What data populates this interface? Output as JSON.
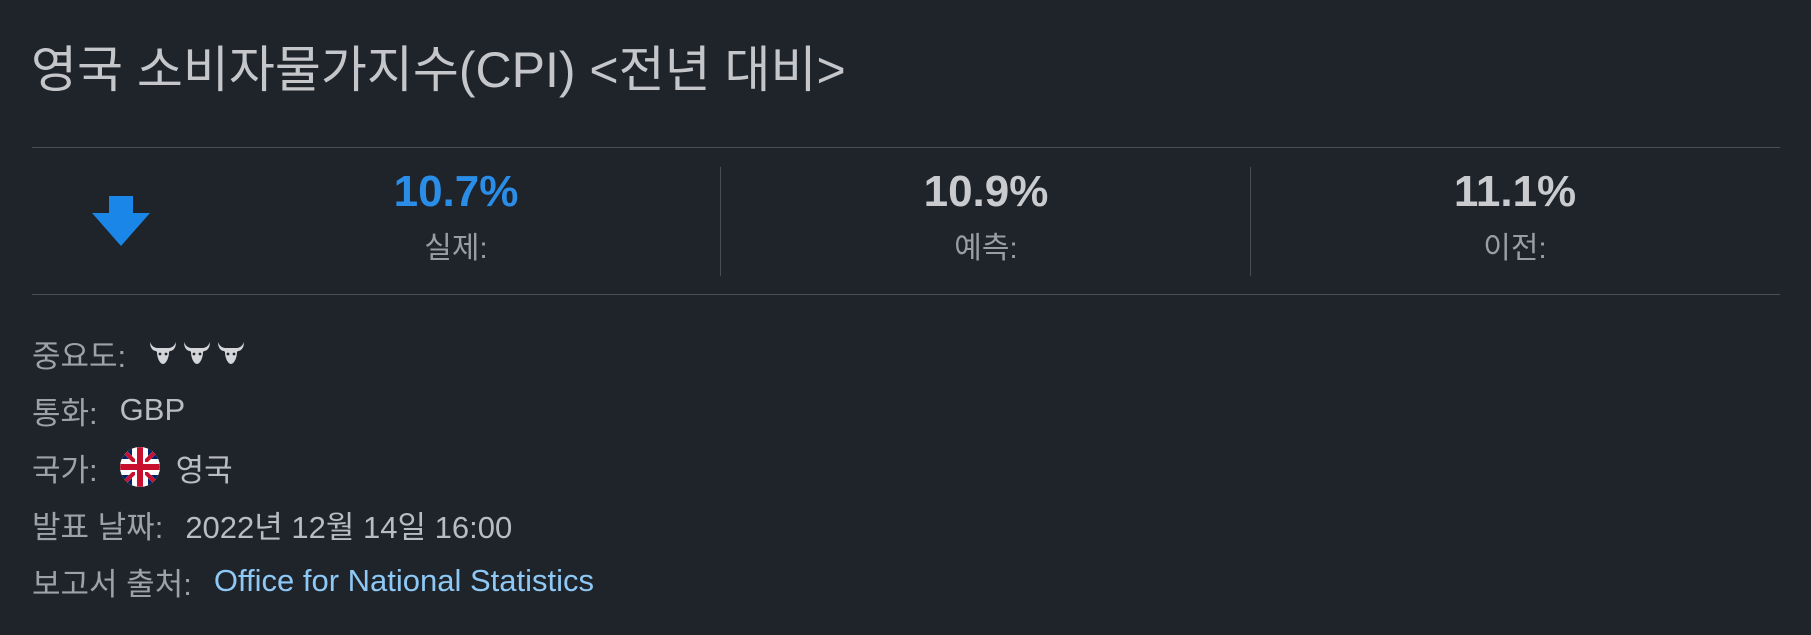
{
  "event": {
    "title": "영국 소비자물가지수(CPI) <전년 대비>"
  },
  "metrics": {
    "direction_icon": "down-arrow-icon",
    "actual": {
      "value": "10.7%",
      "label": "실제:"
    },
    "forecast": {
      "value": "10.9%",
      "label": "예측:"
    },
    "previous": {
      "value": "11.1%",
      "label": "이전:"
    }
  },
  "details": {
    "importance": {
      "label": "중요도:",
      "level": 3,
      "icon": "bull-icon"
    },
    "currency": {
      "label": "통화:",
      "value": "GBP"
    },
    "country": {
      "label": "국가:",
      "value": "영국",
      "flag_icon": "uk-flag-icon"
    },
    "release_date": {
      "label": "발표 날짜:",
      "value": "2022년 12월 14일 16:00"
    },
    "source": {
      "label": "보고서 출처:",
      "value": "Office for National Statistics"
    }
  },
  "colors": {
    "background": "#1f232a",
    "actual_value": "#2a8ee8",
    "arrow": "#1a86e8",
    "link": "#8ec8f5"
  }
}
